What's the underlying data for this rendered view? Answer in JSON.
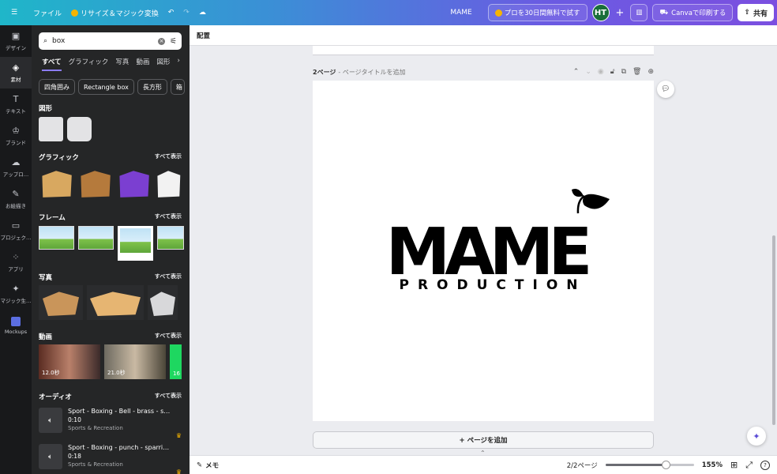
{
  "topbar": {
    "menu_icon": "hamburger-icon",
    "file_label": "ファイル",
    "resize_label": "リサイズ＆マジック変換",
    "design_name": "MAME",
    "trial_label": "プロを30日間無料で試す",
    "avatar_initials": "HT",
    "print_label": "Canvaで印刷する",
    "share_label": "共有",
    "accent_gradient": [
      "#1fb6c9",
      "#7b4fe0"
    ]
  },
  "rail": {
    "items": [
      {
        "label": "デザイン",
        "icon": "layout-icon"
      },
      {
        "label": "素材",
        "icon": "elements-icon"
      },
      {
        "label": "テキスト",
        "icon": "text-icon"
      },
      {
        "label": "ブランド",
        "icon": "brand-icon"
      },
      {
        "label": "アップロ…",
        "icon": "upload-icon"
      },
      {
        "label": "お絵描き",
        "icon": "draw-icon"
      },
      {
        "label": "プロジェク…",
        "icon": "folder-icon"
      },
      {
        "label": "アプリ",
        "icon": "apps-icon"
      },
      {
        "label": "マジック生…",
        "icon": "magic-media-icon"
      },
      {
        "label": "Mockups",
        "icon": "mockups-icon"
      }
    ]
  },
  "panel": {
    "search_value": "box",
    "tabs": [
      "すべて",
      "グラフィック",
      "写真",
      "動画",
      "図形"
    ],
    "chips": [
      "四角囲み",
      "Rectangle box",
      "長方形",
      "箱"
    ],
    "shapes_title": "図形",
    "graphics_title": "グラフィック",
    "frames_title": "フレーム",
    "photos_title": "写真",
    "videos_title": "動画",
    "audio_title": "オーディオ",
    "see_all": "すべて表示",
    "videos": [
      {
        "duration": "12.0秒"
      },
      {
        "duration": "21.0秒"
      },
      {
        "duration": "16"
      }
    ],
    "audio": [
      {
        "title": "Sport - Boxing - Bell - brass - ster…",
        "duration": "0:10",
        "category": "Sports & Recreation"
      },
      {
        "title": "Sport - Boxing - punch - sparring …",
        "duration": "0:18",
        "category": "Sports & Recreation"
      }
    ]
  },
  "context_bar": {
    "label": "配置"
  },
  "canvas": {
    "page_label": "2ページ",
    "page_title_placeholder": "- ページタイトルを追加",
    "logo_main": "MAME",
    "logo_sub": "PRODUCTION",
    "add_page_label": "+ ページを追加"
  },
  "status": {
    "notes_label": "メモ",
    "page_counter": "2/2ページ",
    "zoom": "155%",
    "zoom_fraction": 0.68
  }
}
